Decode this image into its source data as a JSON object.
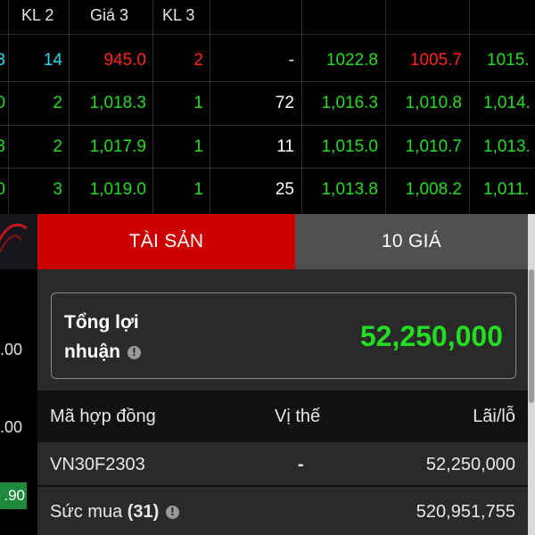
{
  "market": {
    "headers": [
      "KL 2",
      "Giá 3",
      "KL 3"
    ],
    "rows": [
      {
        "c0": "3",
        "kl2": "14",
        "gia3": "945.0",
        "kl3": "2",
        "vol": "-",
        "p1": "1022.8",
        "p2": "1005.7",
        "p3": "1015."
      },
      {
        "c0": "0",
        "kl2": "2",
        "gia3": "1,018.3",
        "kl3": "1",
        "vol": "72",
        "p1": "1,016.3",
        "p2": "1,010.8",
        "p3": "1,014."
      },
      {
        "c0": "3",
        "kl2": "2",
        "gia3": "1,017.9",
        "kl3": "1",
        "vol": "11",
        "p1": "1,015.0",
        "p2": "1,010.7",
        "p3": "1,013."
      },
      {
        "c0": "0",
        "kl2": "3",
        "gia3": "1,019.0",
        "kl3": "1",
        "vol": "25",
        "p1": "1,013.8",
        "p2": "1,008.2",
        "p3": "1,011."
      }
    ]
  },
  "left_strip": {
    "values": [
      ".00",
      ".00"
    ],
    "badge": ".90"
  },
  "tabs": {
    "assets": "TÀI SẢN",
    "ten_prices": "10 GIÁ"
  },
  "profit": {
    "label": "Tổng lợi nhuận",
    "info_glyph": "!",
    "value": "52,250,000"
  },
  "contracts": {
    "headers": {
      "code": "Mã hợp đồng",
      "position": "Vị thế",
      "pnl": "Lãi/lỗ"
    },
    "row": {
      "code": "VN30F2303",
      "position": "-",
      "pnl": "52,250,000"
    }
  },
  "buying_power": {
    "label": "Sức mua",
    "count": "(31)",
    "value": "520,951,755"
  },
  "colors": {
    "accent_red": "#cc0000",
    "up_green": "#22dd22",
    "down_red": "#ff2222",
    "ceiling_cyan": "#22ddee"
  }
}
